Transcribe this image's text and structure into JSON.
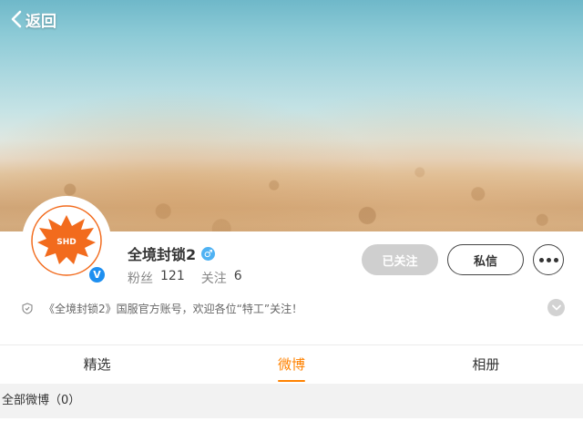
{
  "nav": {
    "back_label": "返回",
    "back_icon": "chevron-left-icon"
  },
  "cover": {
    "description_colors": {
      "sky": "#8ccad6",
      "sand": "#d9b48a"
    }
  },
  "profile": {
    "name": "全境封锁2",
    "gender_symbol": "♂",
    "verified_symbol": "V",
    "stats": [
      {
        "label": "粉丝",
        "value": "121"
      },
      {
        "label": "关注",
        "value": "6"
      }
    ],
    "avatar": {
      "logo_text": "SHD"
    },
    "bio": "《全境封锁2》国服官方账号，欢迎各位“特工”关注！"
  },
  "actions": {
    "following_label": "已关注",
    "message_label": "私信"
  },
  "tabs": [
    {
      "label": "精选",
      "active": false
    },
    {
      "label": "微博",
      "active": true
    },
    {
      "label": "相册",
      "active": false
    }
  ],
  "section": {
    "title": "全部微博（0）"
  },
  "colors": {
    "accent": "#ff8200",
    "verified": "#1e8ff0",
    "gender": "#4fb2f3",
    "logo": "#f26b1d"
  }
}
